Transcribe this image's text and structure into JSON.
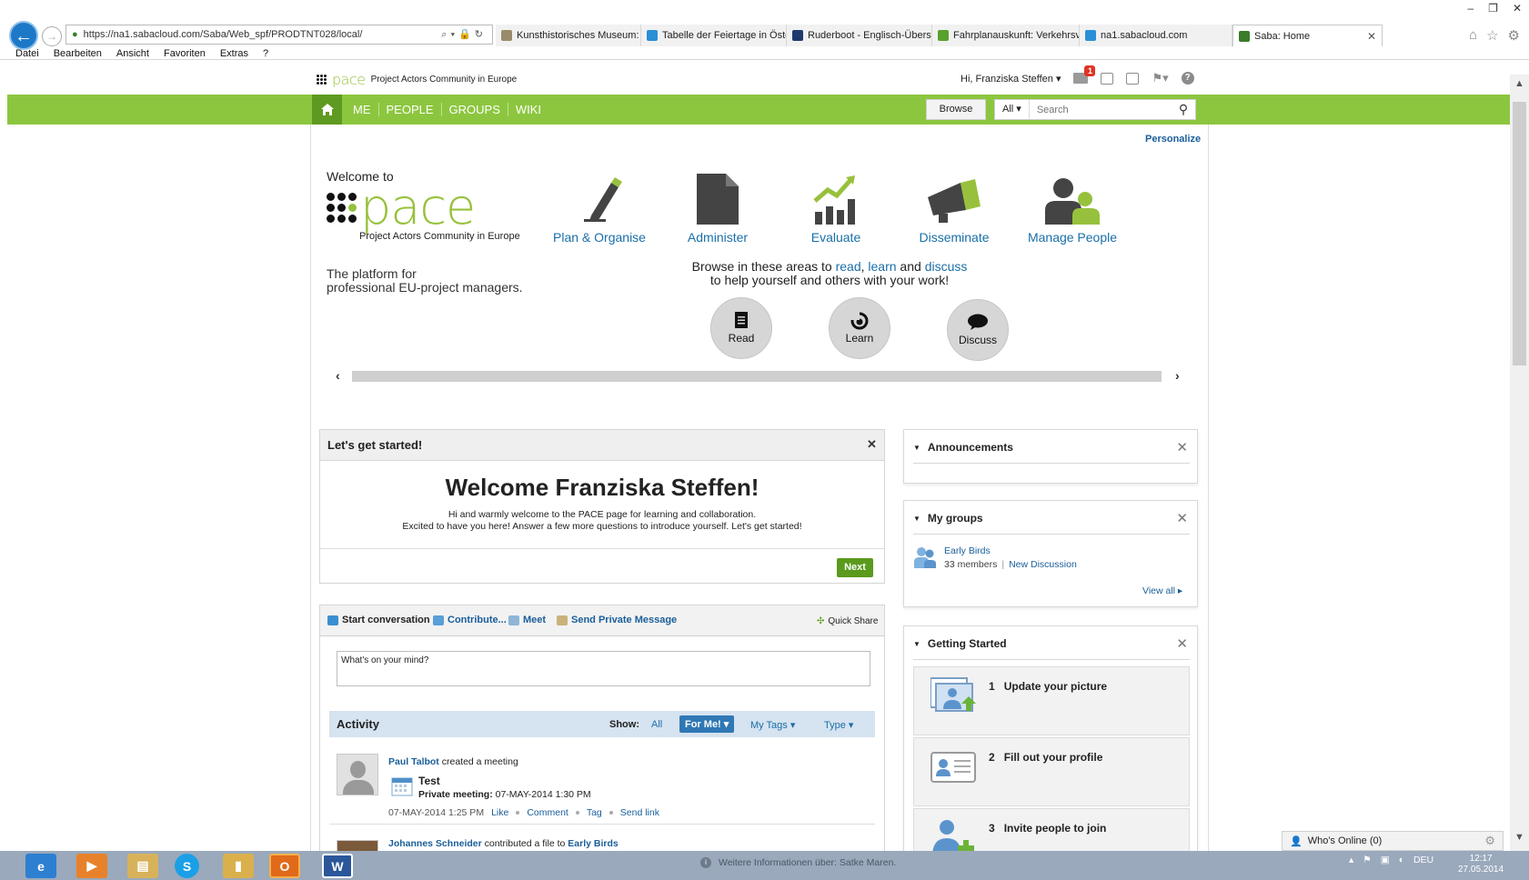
{
  "browser": {
    "url": "https://na1.sabacloud.com/Saba/Web_spf/PRODTNT028/local/",
    "tabs": [
      {
        "title": "Kunsthistorisches Museum: Ka...",
        "color": "#9a8b6a",
        "active": false
      },
      {
        "title": "Tabelle der Feiertage in Österr...",
        "color": "#2a8fd6",
        "active": false
      },
      {
        "title": "Ruderboot - Englisch-Übersetz...",
        "color": "#1f3a6e",
        "active": false
      },
      {
        "title": "Fahrplanauskunft: Verkehrsver...",
        "color": "#5aa02c",
        "active": false
      },
      {
        "title": "na1.sabacloud.com",
        "color": "#2a8fd6",
        "active": false
      },
      {
        "title": "Saba: Home",
        "color": "#3b7c2a",
        "active": true
      }
    ],
    "menu": [
      "Datei",
      "Bearbeiten",
      "Ansicht",
      "Favoriten",
      "Extras",
      "?"
    ]
  },
  "header": {
    "logo_word": "pace",
    "tagline": "Project Actors Community in Europe",
    "greeting": "Hi, Franziska Steffen",
    "mail_count": "1"
  },
  "nav": {
    "items": [
      "ME",
      "PEOPLE",
      "GROUPS",
      "WIKI"
    ],
    "browse_label": "Browse",
    "search_scope": "All",
    "search_placeholder": "Search"
  },
  "hero": {
    "personalize": "Personalize",
    "welcome_to": "Welcome to",
    "logo_word": "pace",
    "tagline": "Project Actors Community in Europe",
    "platform_line1": "The platform for",
    "platform_line2": "professional EU-project managers.",
    "areas": [
      "Plan & Organise",
      "Administer",
      "Evaluate",
      "Disseminate",
      "Manage People"
    ],
    "browse_text_1": "Browse in these areas to ",
    "browse_read": "read",
    "browse_comma": ", ",
    "browse_learn": "learn",
    "browse_and": " and ",
    "browse_discuss": "discuss",
    "browse_text_2": "to help yourself and others with your work!",
    "circles": [
      "Read",
      "Learn",
      "Discuss"
    ]
  },
  "get_started": {
    "title": "Let's get started!",
    "heading": "Welcome Franziska Steffen!",
    "line1": "Hi and warmly welcome to the PACE page for learning and collaboration.",
    "line2": "Excited to have you here! Answer a few more questions to introduce yourself. Let's get started!",
    "next": "Next"
  },
  "conversation": {
    "tabs": [
      "Start conversation",
      "Contribute...",
      "Meet",
      "Send Private Message"
    ],
    "quick_share": "Quick Share",
    "input_placeholder": "What's on your mind?"
  },
  "activity": {
    "title": "Activity",
    "show_label": "Show:",
    "filters": [
      "All",
      "For Me!",
      "My Tags",
      "Type"
    ],
    "feed": [
      {
        "actor": "Paul Talbot",
        "action": " created a meeting",
        "item_title": "Test",
        "detail_label": "Private meeting:",
        "detail_value": " 07-MAY-2014 1:30 PM",
        "time": "07-MAY-2014 1:25 PM",
        "actions": [
          "Like",
          "Comment",
          "Tag",
          "Send link"
        ]
      },
      {
        "actor": "Johannes Schneider",
        "action": " contributed a file to ",
        "target": "Early Birds"
      }
    ]
  },
  "sidebar": {
    "announcements": "Announcements",
    "my_groups": "My groups",
    "group_name": "Early Birds",
    "group_members": "33 members",
    "new_discussion": "New Discussion",
    "view_all": "View all",
    "getting_started": "Getting Started",
    "steps": [
      {
        "num": "1",
        "label": "Update your picture"
      },
      {
        "num": "2",
        "label": "Fill out your profile"
      },
      {
        "num": "3",
        "label": "Invite people to join"
      }
    ]
  },
  "whos_online": "Who's Online (0)",
  "taskbar": {
    "status": "Weitere Informationen über: Satke Maren.",
    "lang": "DEU",
    "time": "12:17",
    "date": "27.05.2014"
  },
  "colors": {
    "nav_green": "#8cc63f",
    "home_green": "#5f9a20",
    "link_blue": "#1a6ea8",
    "next_green": "#5a9a1c",
    "logo_green": "#97c13c"
  }
}
